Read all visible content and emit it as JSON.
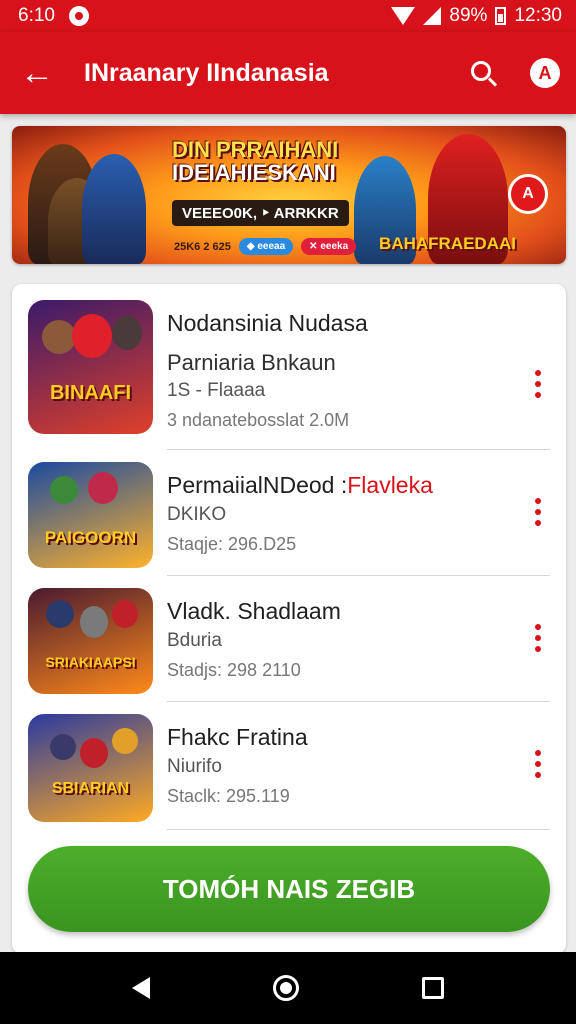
{
  "status_bar": {
    "time_left": "6:10",
    "battery": "89%",
    "clock": "12:30"
  },
  "app_bar": {
    "title": "INraanary IIndanasia",
    "back_icon": "arrow-left-icon",
    "search_icon": "search-icon",
    "profile_icon": "profile-icon",
    "profile_letter": "A"
  },
  "banner": {
    "headline_1": "DIN PRRAIHANI",
    "headline_2": "IDEIAHIESKANI",
    "subline": "VEEEO0K, ‣ ARRKKR",
    "date": "25K6 2 625",
    "chip_1": "◆ eeeaa",
    "chip_2": "✕ eeeka",
    "logo": "BAHAFRAEDAAI",
    "badge": "A"
  },
  "games": [
    {
      "title": "Nodansinia Nudasa",
      "subtitle": "Parniaria Bnkaun",
      "info": "1S - Flaaaa",
      "meta": "3 ndanatebosslat 2.0M",
      "thumb_label": "BINAAFI",
      "thumb_colors": [
        "#3a1a6a",
        "#e0402a"
      ]
    },
    {
      "title": "PermaiialNDeod",
      "title_accent": "Flavleka",
      "subtitle": "DKIKO",
      "meta": "Staqje: 296.D25",
      "thumb_label": "PAIGOORN",
      "thumb_colors": [
        "#1a4aa0",
        "#ffb22a"
      ]
    },
    {
      "title": "Vladk. Shadlaam",
      "subtitle": "Bduria",
      "meta": "Stadjs: 298 2110",
      "thumb_label": "SRIAKIAAPSI",
      "thumb_colors": [
        "#4a1a30",
        "#ff8a1a"
      ]
    },
    {
      "title": "Fhakc Fratina",
      "subtitle": "Niurifo",
      "meta": "Staclk: 295.119",
      "thumb_label": "SBIARIAN",
      "thumb_colors": [
        "#2a3aa0",
        "#ffaa22"
      ]
    }
  ],
  "cta": {
    "label": "TOMÓH NAIS ZEGIB"
  },
  "nav": {
    "back": "nav-back-icon",
    "home": "nav-home-icon",
    "recent": "nav-recents-icon"
  }
}
